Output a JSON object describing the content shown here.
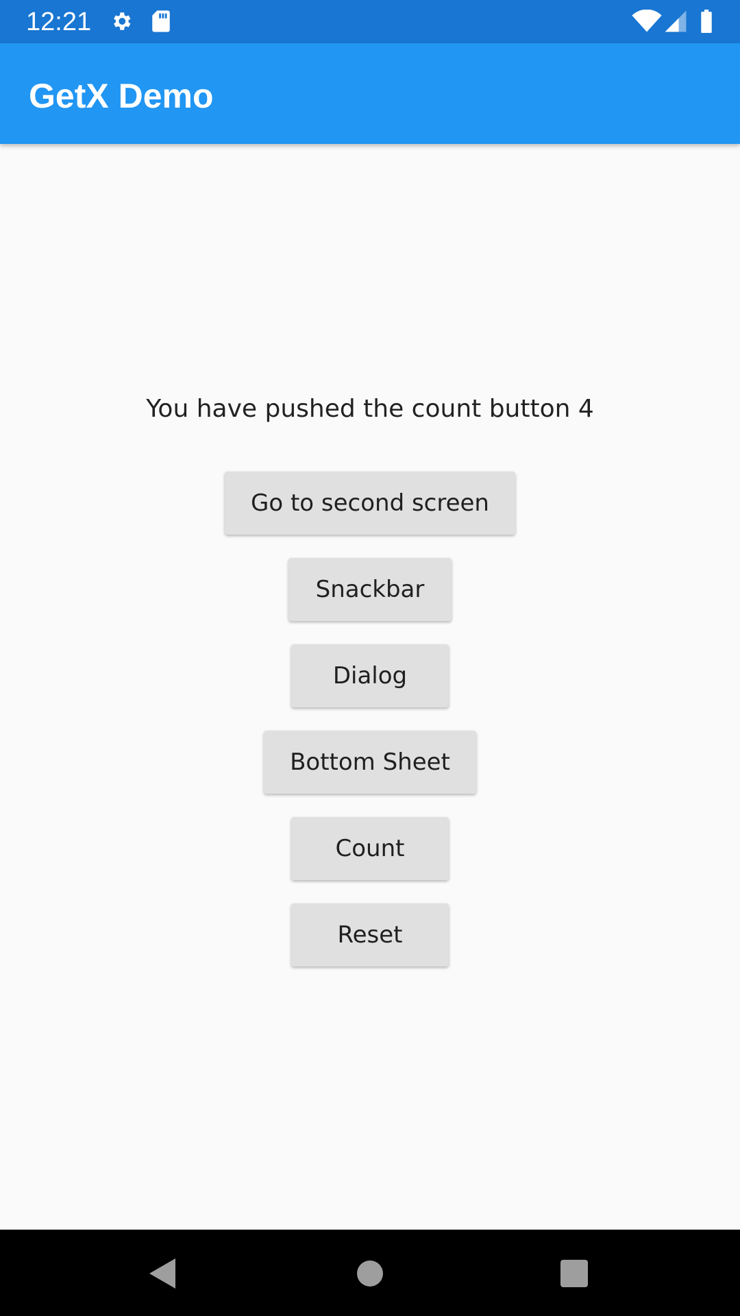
{
  "status_bar": {
    "time": "12:21",
    "icons": [
      "gear-icon",
      "sd-card-icon",
      "wifi-icon",
      "signal-icon",
      "battery-icon"
    ]
  },
  "app_bar": {
    "title": "GetX Demo",
    "color": "#2196f3"
  },
  "main": {
    "counter_text": "You have pushed the count button 4",
    "buttons": [
      {
        "label": "Go to second screen"
      },
      {
        "label": "Snackbar"
      },
      {
        "label": "Dialog"
      },
      {
        "label": "Bottom Sheet"
      },
      {
        "label": "Count"
      },
      {
        "label": "Reset"
      }
    ]
  },
  "nav_bar": {
    "icons": [
      "back-icon",
      "home-icon",
      "recent-apps-icon"
    ]
  }
}
